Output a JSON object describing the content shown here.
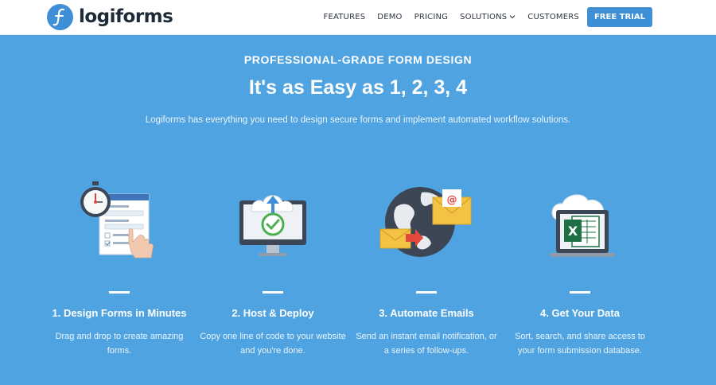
{
  "brand": {
    "name": "logiforms"
  },
  "nav": {
    "items": [
      "FEATURES",
      "DEMO",
      "PRICING",
      "SOLUTIONS",
      "CUSTOMERS"
    ],
    "cta": "FREE TRIAL"
  },
  "hero": {
    "eyebrow": "PROFESSIONAL-GRADE FORM DESIGN",
    "headline": "It's as Easy as 1, 2, 3, 4",
    "lede": "Logiforms has everything you need to design secure forms and implement automated workflow solutions."
  },
  "features": [
    {
      "title": "1. Design Forms in Minutes",
      "description": "Drag and drop to create amazing forms.",
      "icon": "stopwatch-form-hand-icon"
    },
    {
      "title": "2. Host & Deploy",
      "description": "Copy one line of code to your website and you're done.",
      "icon": "cloud-monitor-upload-icon"
    },
    {
      "title": "3. Automate Emails",
      "description": "Send an instant email notification, or a series of follow-ups.",
      "icon": "globe-envelopes-icon"
    },
    {
      "title": "4. Get Your Data",
      "description": "Sort, search, and share access to your form submission database.",
      "icon": "cloud-laptop-excel-icon"
    }
  ],
  "colors": {
    "primary": "#3f8fd6",
    "hero_bg": "#4fa3e0",
    "text_dark": "#1f2a38"
  }
}
